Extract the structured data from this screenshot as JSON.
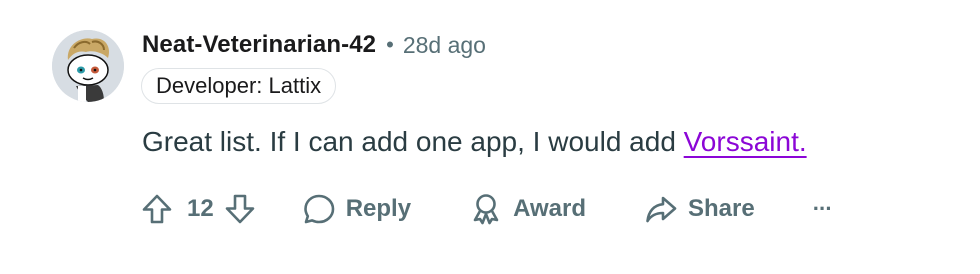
{
  "comment": {
    "username": "Neat-Veterinarian-42",
    "separator": "•",
    "time": "28d ago",
    "flair": "Developer: Lattix",
    "body_prefix": "Great list. If I can add one app, I would add ",
    "link_text": "Vorssaint.",
    "link_color": "#8b06d6"
  },
  "actions": {
    "vote_count": "12",
    "reply_label": "Reply",
    "award_label": "Award",
    "share_label": "Share",
    "more_label": "···"
  },
  "icons": {
    "upvote": "upvote-arrow-icon",
    "downvote": "downvote-arrow-icon",
    "reply": "speech-bubble-icon",
    "award": "award-ribbon-icon",
    "share": "share-arrow-icon",
    "more": "ellipsis-icon"
  },
  "colors": {
    "text": "#1a1a1b",
    "muted": "#576f76",
    "link": "#8b06d6"
  }
}
